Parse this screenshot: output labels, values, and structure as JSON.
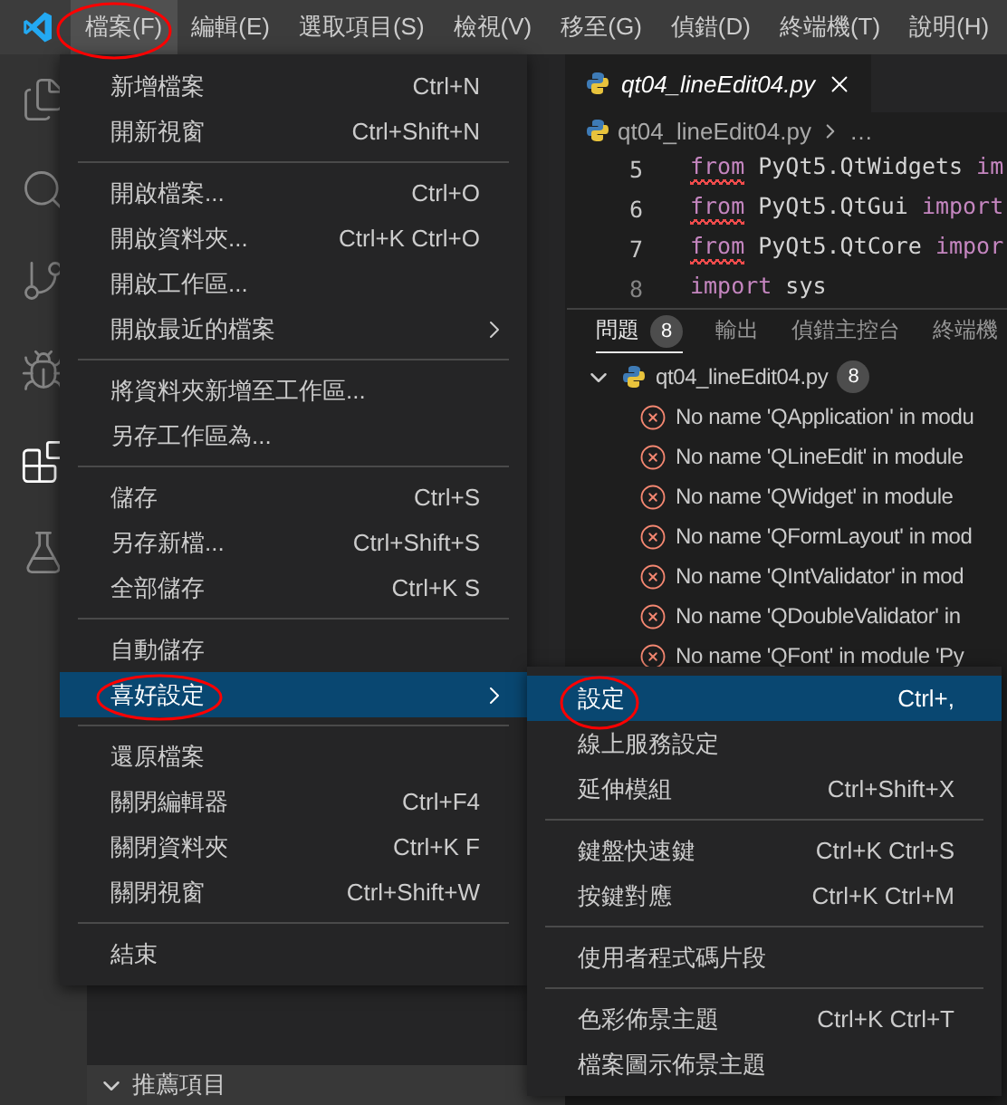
{
  "menubar": [
    {
      "label": "檔案(F)",
      "selected": true
    },
    {
      "label": "編輯(E)",
      "selected": false
    },
    {
      "label": "選取項目(S)",
      "selected": false
    },
    {
      "label": "檢視(V)",
      "selected": false
    },
    {
      "label": "移至(G)",
      "selected": false
    },
    {
      "label": "偵錯(D)",
      "selected": false
    },
    {
      "label": "終端機(T)",
      "selected": false
    },
    {
      "label": "說明(H)",
      "selected": false
    }
  ],
  "activity_bar": [
    {
      "kind": "files",
      "selected": false
    },
    {
      "kind": "search",
      "selected": false
    },
    {
      "kind": "source-control",
      "selected": false
    },
    {
      "kind": "debug",
      "selected": false
    },
    {
      "kind": "extensions",
      "selected": true
    },
    {
      "kind": "testing",
      "selected": false
    }
  ],
  "sidebar": {
    "section": {
      "title": "推薦項目",
      "expanded": true
    }
  },
  "editor": {
    "tab": {
      "label": "qt04_lineEdit04.py"
    },
    "breadcrumb": {
      "file": "qt04_lineEdit04.py",
      "rest": "…"
    },
    "lines": [
      {
        "number": "5",
        "error": true,
        "tokens": [
          {
            "kind": "keyword",
            "text": "from"
          },
          {
            "kind": "plain",
            "text": " PyQt5.QtWidgets "
          },
          {
            "kind": "keyword",
            "text": "im"
          }
        ]
      },
      {
        "number": "6",
        "error": true,
        "tokens": [
          {
            "kind": "keyword",
            "text": "from"
          },
          {
            "kind": "plain",
            "text": " PyQt5.QtGui "
          },
          {
            "kind": "keyword",
            "text": "import"
          }
        ]
      },
      {
        "number": "7",
        "error": true,
        "tokens": [
          {
            "kind": "keyword",
            "text": "from"
          },
          {
            "kind": "plain",
            "text": " PyQt5.QtCore "
          },
          {
            "kind": "keyword",
            "text": "impor"
          }
        ]
      },
      {
        "number": "8",
        "error": false,
        "tokens": [
          {
            "kind": "keyword",
            "text": "import"
          },
          {
            "kind": "plain",
            "text": " sys"
          }
        ]
      }
    ]
  },
  "panel": {
    "tabs": [
      {
        "label": "問題",
        "badge": "8",
        "selected": true
      },
      {
        "label": "輸出",
        "selected": false
      },
      {
        "label": "偵錯主控台",
        "selected": false
      },
      {
        "label": "終端機",
        "selected": false
      }
    ],
    "file": {
      "name": "qt04_lineEdit04.py",
      "count": "8",
      "expanded": true
    },
    "problems": [
      "No name 'QApplication' in modu",
      "No name 'QLineEdit' in module",
      "No name 'QWidget' in module",
      "No name 'QFormLayout' in mod",
      "No name 'QIntValidator' in mod",
      "No name 'QDoubleValidator' in",
      "No name 'QFont' in module 'Py"
    ]
  },
  "file_menu": {
    "groups": [
      [
        {
          "label": "新增檔案",
          "shortcut": "Ctrl+N",
          "submenu": false,
          "selected": false
        },
        {
          "label": "開新視窗",
          "shortcut": "Ctrl+Shift+N",
          "submenu": false,
          "selected": false
        }
      ],
      [
        {
          "label": "開啟檔案...",
          "shortcut": "Ctrl+O",
          "submenu": false,
          "selected": false
        },
        {
          "label": "開啟資料夾...",
          "shortcut": "Ctrl+K Ctrl+O",
          "submenu": false,
          "selected": false
        },
        {
          "label": "開啟工作區...",
          "submenu": false,
          "selected": false
        },
        {
          "label": "開啟最近的檔案",
          "submenu": true,
          "selected": false
        }
      ],
      [
        {
          "label": "將資料夾新增至工作區...",
          "submenu": false,
          "selected": false
        },
        {
          "label": "另存工作區為...",
          "submenu": false,
          "selected": false
        }
      ],
      [
        {
          "label": "儲存",
          "shortcut": "Ctrl+S",
          "submenu": false,
          "selected": false
        },
        {
          "label": "另存新檔...",
          "shortcut": "Ctrl+Shift+S",
          "submenu": false,
          "selected": false
        },
        {
          "label": "全部儲存",
          "shortcut": "Ctrl+K S",
          "submenu": false,
          "selected": false
        }
      ],
      [
        {
          "label": "自動儲存",
          "submenu": false,
          "selected": false
        },
        {
          "label": "喜好設定",
          "submenu": true,
          "selected": true
        }
      ],
      [
        {
          "label": "還原檔案",
          "submenu": false,
          "selected": false
        },
        {
          "label": "關閉編輯器",
          "shortcut": "Ctrl+F4",
          "submenu": false,
          "selected": false
        },
        {
          "label": "關閉資料夾",
          "shortcut": "Ctrl+K F",
          "submenu": false,
          "selected": false
        },
        {
          "label": "關閉視窗",
          "shortcut": "Ctrl+Shift+W",
          "submenu": false,
          "selected": false
        }
      ],
      [
        {
          "label": "結束",
          "submenu": false,
          "selected": false
        }
      ]
    ]
  },
  "preferences_menu": {
    "groups": [
      [
        {
          "label": "設定",
          "shortcut": "Ctrl+,",
          "submenu": false,
          "selected": true
        },
        {
          "label": "線上服務設定",
          "submenu": false,
          "selected": false
        },
        {
          "label": "延伸模組",
          "shortcut": "Ctrl+Shift+X",
          "submenu": false,
          "selected": false
        }
      ],
      [
        {
          "label": "鍵盤快速鍵",
          "shortcut": "Ctrl+K Ctrl+S",
          "submenu": false,
          "selected": false
        },
        {
          "label": "按鍵對應",
          "shortcut": "Ctrl+K Ctrl+M",
          "submenu": false,
          "selected": false
        }
      ],
      [
        {
          "label": "使用者程式碼片段",
          "submenu": false,
          "selected": false
        }
      ],
      [
        {
          "label": "色彩佈景主題",
          "shortcut": "Ctrl+K Ctrl+T",
          "submenu": false,
          "selected": false
        },
        {
          "label": "檔案圖示佈景主題",
          "submenu": false,
          "selected": false
        }
      ]
    ]
  }
}
